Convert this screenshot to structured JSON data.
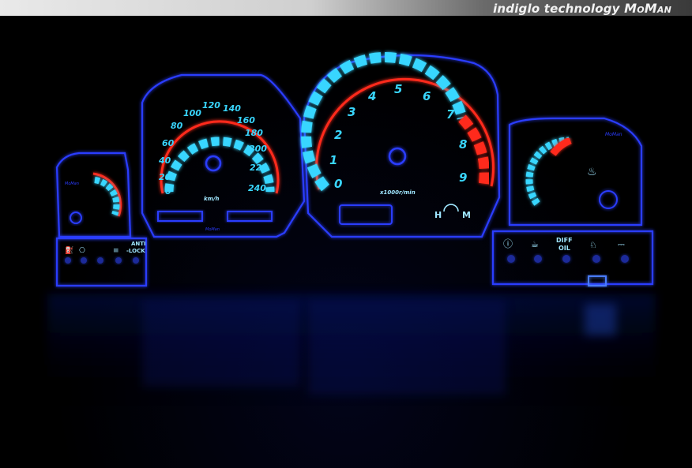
{
  "banner": {
    "prefix": "indiglo technology",
    "brand": "MoMan"
  },
  "speedometer": {
    "ticks": [
      "0",
      "20",
      "40",
      "60",
      "80",
      "100",
      "120",
      "140",
      "160",
      "180",
      "200",
      "220",
      "240"
    ],
    "unit": "km/h",
    "maker": "MoMan"
  },
  "tachometer": {
    "ticks": [
      "0",
      "1",
      "2",
      "3",
      "4",
      "5",
      "6",
      "7",
      "8",
      "9"
    ],
    "unit": "x1000r/min",
    "hm_left": "H",
    "hm_right": "M"
  },
  "temp_gauge": {
    "maker": "MoMan"
  },
  "fuel_gauge": {
    "maker": "MoMan"
  },
  "left_warnings": {
    "anti_lock_line1": "ANTI",
    "anti_lock_line2": "-LOCK"
  },
  "right_warnings": {
    "diff_oil_line1": "DIFF",
    "diff_oil_line2": "OIL"
  },
  "colors": {
    "glow_blue": "#1a3cff",
    "cyan": "#39d6ff",
    "red": "#ff2a1a",
    "background": "#000000"
  }
}
